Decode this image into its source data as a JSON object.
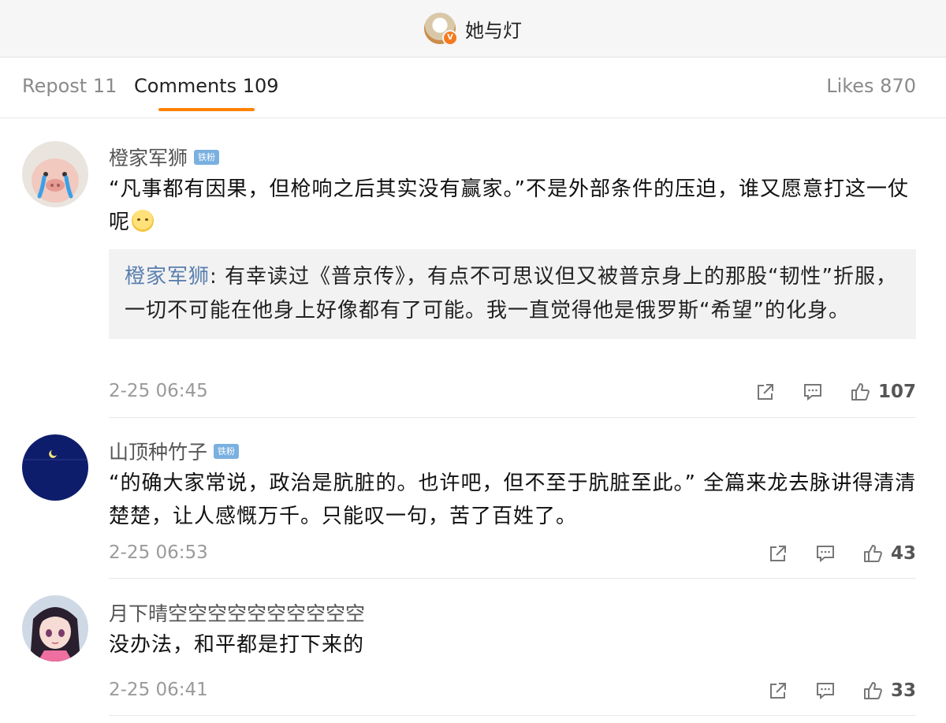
{
  "header": {
    "account_name": "她与灯",
    "verified_badge": "V"
  },
  "tabs": {
    "repost": "Repost 11",
    "comments": "Comments 109",
    "likes": "Likes 870"
  },
  "colors": {
    "accent": "#ff8200",
    "link_blue": "#5a7fae",
    "badge_blue": "#7ab0e0"
  },
  "comments": [
    {
      "username": "橙家军狮",
      "badge": "铁粉",
      "text": "“凡事都有因果，但枪响之后其实没有赢家。”不是外部条件的压迫，谁又愿意打这一仗呢",
      "emoji": "sad-face-emoji",
      "quote_author": "橙家军狮",
      "quote_text": ": 有幸读过《普京传》，有点不可思议但又被普京身上的那股“韧性”折服，一切不可能在他身上好像都有了可能。我一直觉得他是俄罗斯“希望”的化身。",
      "time": "2-25 06:45",
      "likes": "107"
    },
    {
      "username": "山顶种竹子",
      "badge": "铁粉",
      "text": "“的确大家常说，政治是肮脏的。也许吧，但不至于肮脏至此。” 全篇来龙去脉讲得清清楚楚，让人感慨万千。只能叹一句，苦了百姓了。",
      "time": "2-25 06:53",
      "likes": "43"
    },
    {
      "username": "月下晴空空空空空空空空空空",
      "text": "没办法，和平都是打下来的",
      "time": "2-25 06:41",
      "likes": "33"
    }
  ],
  "icons": {
    "share": "share-icon",
    "reply": "comment-icon",
    "like": "thumbs-up-icon"
  }
}
